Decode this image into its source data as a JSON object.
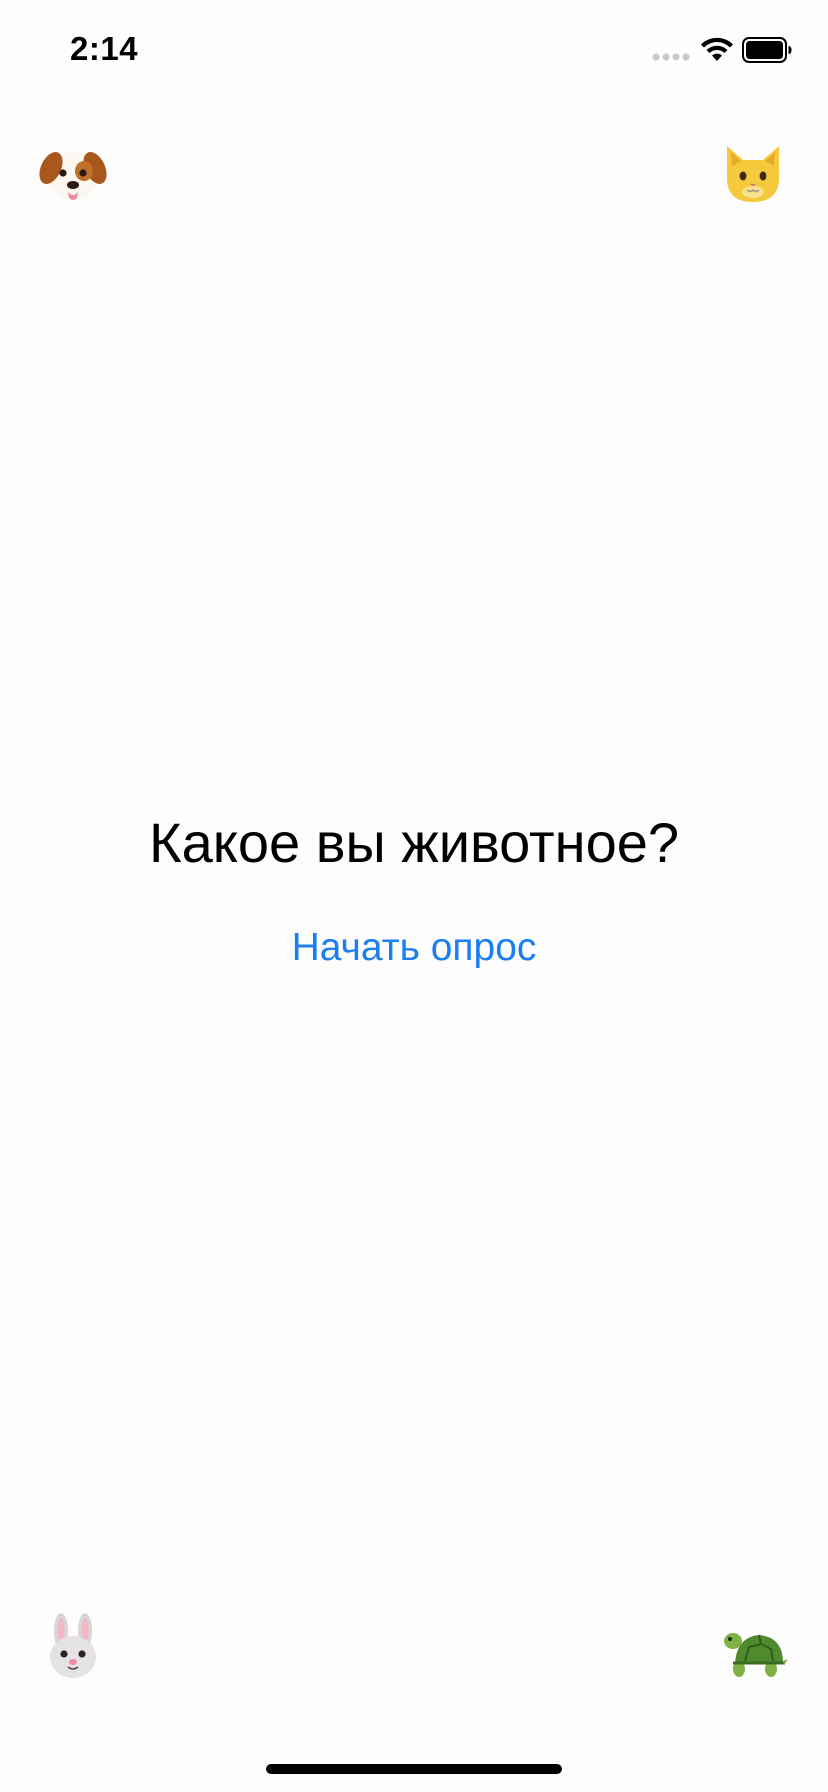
{
  "status_bar": {
    "time": "2:14"
  },
  "corners": {
    "top_left": {
      "icon": "dog-face-icon",
      "glyph": "🐶"
    },
    "top_right": {
      "icon": "cat-face-icon",
      "glyph": "🐱"
    },
    "bottom_left": {
      "icon": "rabbit-face-icon",
      "glyph": "🐰"
    },
    "bottom_right": {
      "icon": "turtle-icon",
      "glyph": "🐢"
    }
  },
  "main": {
    "title": "Какое вы животное?",
    "start_button_label": "Начать опрос"
  },
  "colors": {
    "accent": "#1b7ff0",
    "background": "#fdfdfd",
    "text": "#000000"
  }
}
